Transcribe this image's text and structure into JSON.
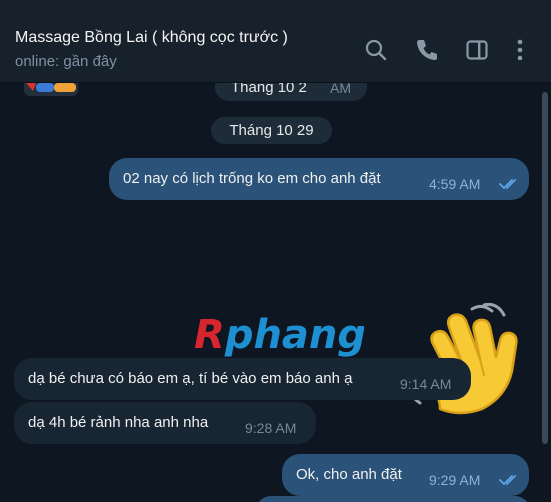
{
  "header": {
    "title": "Massage Bồng Lai ( không cọc trước )",
    "status": "online: gần đây",
    "icons": [
      "search-icon",
      "phone-icon",
      "sidebar-toggle-icon",
      "more-vertical-icon"
    ]
  },
  "messages": {
    "prev_date": "Tháng 10 2",
    "prev_time": "AM",
    "date": "Tháng 10 29",
    "m1": {
      "text": "02 nay có lịch trống ko em cho anh đặt",
      "time": "4:59 AM"
    },
    "m3": {
      "text": "dạ bé chưa có báo em ạ, tí bé vào em báo anh ạ",
      "time": "9:14 AM"
    },
    "m4": {
      "text": "dạ 4h bé rảnh nha anh nha",
      "time": "9:28 AM"
    },
    "m5": {
      "text": "Ok, cho anh đặt",
      "time": "9:29 AM"
    }
  },
  "sticker": {
    "name": "waving-hand-sticker",
    "emoji": "👋"
  },
  "watermark": {
    "text": "Rphang"
  },
  "colors": {
    "background": "#0e1621",
    "header": "#17212b",
    "incoming_bubble": "#182533",
    "outgoing_bubble": "#2b5278",
    "read_ticks": "#5fa5e8",
    "watermark_red": "#d7262d",
    "watermark_blue": "#1e8fd1"
  }
}
